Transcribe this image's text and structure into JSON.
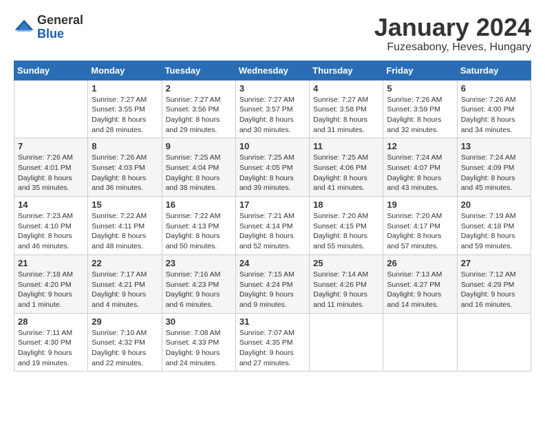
{
  "logo": {
    "general": "General",
    "blue": "Blue"
  },
  "title": "January 2024",
  "location": "Fuzesabony, Heves, Hungary",
  "days_header": [
    "Sunday",
    "Monday",
    "Tuesday",
    "Wednesday",
    "Thursday",
    "Friday",
    "Saturday"
  ],
  "weeks": [
    [
      {
        "day": "",
        "info": ""
      },
      {
        "day": "1",
        "info": "Sunrise: 7:27 AM\nSunset: 3:55 PM\nDaylight: 8 hours\nand 28 minutes."
      },
      {
        "day": "2",
        "info": "Sunrise: 7:27 AM\nSunset: 3:56 PM\nDaylight: 8 hours\nand 29 minutes."
      },
      {
        "day": "3",
        "info": "Sunrise: 7:27 AM\nSunset: 3:57 PM\nDaylight: 8 hours\nand 30 minutes."
      },
      {
        "day": "4",
        "info": "Sunrise: 7:27 AM\nSunset: 3:58 PM\nDaylight: 8 hours\nand 31 minutes."
      },
      {
        "day": "5",
        "info": "Sunrise: 7:26 AM\nSunset: 3:59 PM\nDaylight: 8 hours\nand 32 minutes."
      },
      {
        "day": "6",
        "info": "Sunrise: 7:26 AM\nSunset: 4:00 PM\nDaylight: 8 hours\nand 34 minutes."
      }
    ],
    [
      {
        "day": "7",
        "info": "Sunrise: 7:26 AM\nSunset: 4:01 PM\nDaylight: 8 hours\nand 35 minutes."
      },
      {
        "day": "8",
        "info": "Sunrise: 7:26 AM\nSunset: 4:03 PM\nDaylight: 8 hours\nand 36 minutes."
      },
      {
        "day": "9",
        "info": "Sunrise: 7:25 AM\nSunset: 4:04 PM\nDaylight: 8 hours\nand 38 minutes."
      },
      {
        "day": "10",
        "info": "Sunrise: 7:25 AM\nSunset: 4:05 PM\nDaylight: 8 hours\nand 39 minutes."
      },
      {
        "day": "11",
        "info": "Sunrise: 7:25 AM\nSunset: 4:06 PM\nDaylight: 8 hours\nand 41 minutes."
      },
      {
        "day": "12",
        "info": "Sunrise: 7:24 AM\nSunset: 4:07 PM\nDaylight: 8 hours\nand 43 minutes."
      },
      {
        "day": "13",
        "info": "Sunrise: 7:24 AM\nSunset: 4:09 PM\nDaylight: 8 hours\nand 45 minutes."
      }
    ],
    [
      {
        "day": "14",
        "info": "Sunrise: 7:23 AM\nSunset: 4:10 PM\nDaylight: 8 hours\nand 46 minutes."
      },
      {
        "day": "15",
        "info": "Sunrise: 7:22 AM\nSunset: 4:11 PM\nDaylight: 8 hours\nand 48 minutes."
      },
      {
        "day": "16",
        "info": "Sunrise: 7:22 AM\nSunset: 4:13 PM\nDaylight: 8 hours\nand 50 minutes."
      },
      {
        "day": "17",
        "info": "Sunrise: 7:21 AM\nSunset: 4:14 PM\nDaylight: 8 hours\nand 52 minutes."
      },
      {
        "day": "18",
        "info": "Sunrise: 7:20 AM\nSunset: 4:15 PM\nDaylight: 8 hours\nand 55 minutes."
      },
      {
        "day": "19",
        "info": "Sunrise: 7:20 AM\nSunset: 4:17 PM\nDaylight: 8 hours\nand 57 minutes."
      },
      {
        "day": "20",
        "info": "Sunrise: 7:19 AM\nSunset: 4:18 PM\nDaylight: 8 hours\nand 59 minutes."
      }
    ],
    [
      {
        "day": "21",
        "info": "Sunrise: 7:18 AM\nSunset: 4:20 PM\nDaylight: 9 hours\nand 1 minute."
      },
      {
        "day": "22",
        "info": "Sunrise: 7:17 AM\nSunset: 4:21 PM\nDaylight: 9 hours\nand 4 minutes."
      },
      {
        "day": "23",
        "info": "Sunrise: 7:16 AM\nSunset: 4:23 PM\nDaylight: 9 hours\nand 6 minutes."
      },
      {
        "day": "24",
        "info": "Sunrise: 7:15 AM\nSunset: 4:24 PM\nDaylight: 9 hours\nand 9 minutes."
      },
      {
        "day": "25",
        "info": "Sunrise: 7:14 AM\nSunset: 4:26 PM\nDaylight: 9 hours\nand 11 minutes."
      },
      {
        "day": "26",
        "info": "Sunrise: 7:13 AM\nSunset: 4:27 PM\nDaylight: 9 hours\nand 14 minutes."
      },
      {
        "day": "27",
        "info": "Sunrise: 7:12 AM\nSunset: 4:29 PM\nDaylight: 9 hours\nand 16 minutes."
      }
    ],
    [
      {
        "day": "28",
        "info": "Sunrise: 7:11 AM\nSunset: 4:30 PM\nDaylight: 9 hours\nand 19 minutes."
      },
      {
        "day": "29",
        "info": "Sunrise: 7:10 AM\nSunset: 4:32 PM\nDaylight: 9 hours\nand 22 minutes."
      },
      {
        "day": "30",
        "info": "Sunrise: 7:08 AM\nSunset: 4:33 PM\nDaylight: 9 hours\nand 24 minutes."
      },
      {
        "day": "31",
        "info": "Sunrise: 7:07 AM\nSunset: 4:35 PM\nDaylight: 9 hours\nand 27 minutes."
      },
      {
        "day": "",
        "info": ""
      },
      {
        "day": "",
        "info": ""
      },
      {
        "day": "",
        "info": ""
      }
    ]
  ]
}
